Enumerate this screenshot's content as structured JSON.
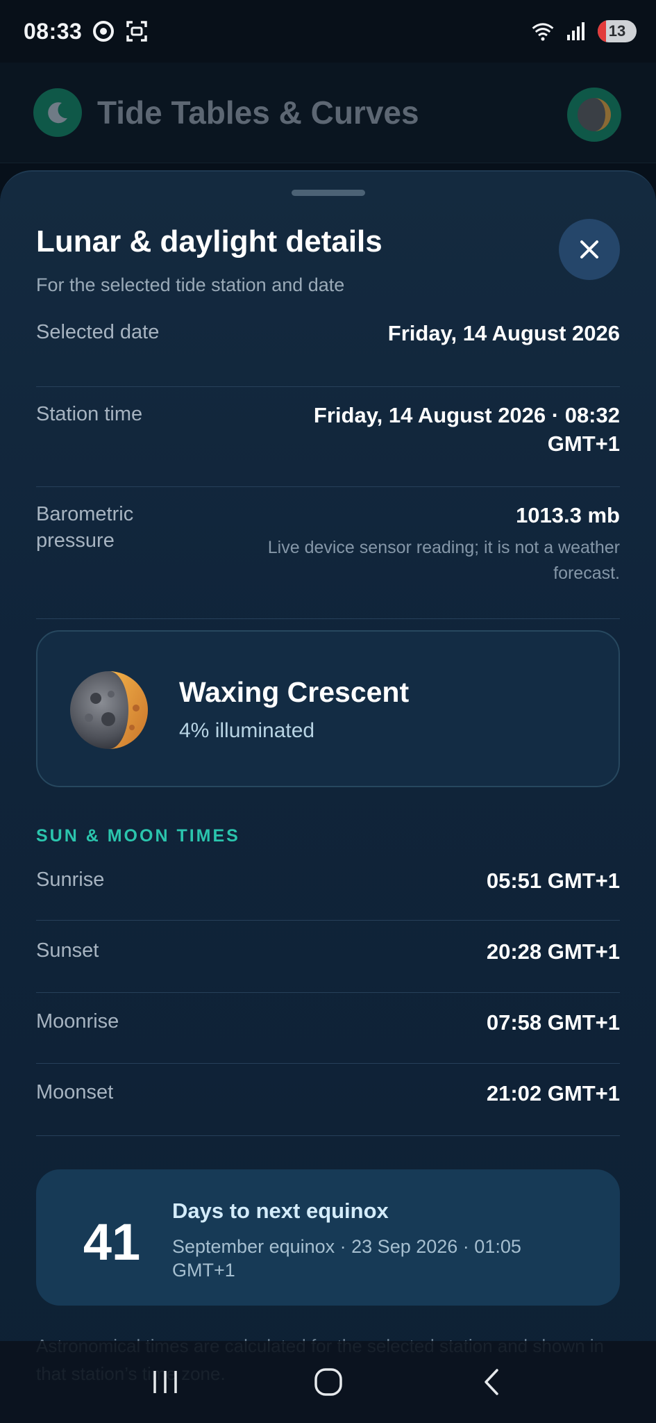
{
  "status_bar": {
    "time": "08:33",
    "battery": "13"
  },
  "app_bar": {
    "title": "Tide Tables & Curves"
  },
  "sheet": {
    "title": "Lunar & daylight details",
    "subtitle": "For the selected tide station and date",
    "details": [
      {
        "label": "Selected date",
        "value": "Friday, 14 August 2026"
      },
      {
        "label": "Station time",
        "value": "Friday, 14 August 2026 · 08:32 GMT+1"
      },
      {
        "label": "Barometric pressure",
        "value": "1013.3 mb",
        "note": "Live device sensor reading; it is not a weather forecast."
      }
    ],
    "moon_phase": {
      "name": "Waxing Crescent",
      "illumination": "4% illuminated"
    },
    "times_heading": "SUN & MOON TIMES",
    "times": [
      {
        "label": "Sunrise",
        "value": "05:51 GMT+1"
      },
      {
        "label": "Sunset",
        "value": "20:28 GMT+1"
      },
      {
        "label": "Moonrise",
        "value": "07:58 GMT+1"
      },
      {
        "label": "Moonset",
        "value": "21:02 GMT+1"
      }
    ],
    "equinox": {
      "days": "41",
      "title": "Days to next equinox",
      "detail": "September equinox · 23 Sep 2026 · 01:05 GMT+1"
    },
    "footnote": "Astronomical times are calculated for the selected station and shown in that station’s time zone."
  },
  "colors": {
    "accent": "#2bc5ad",
    "sheet_background": "#132a40",
    "card_background": "#173a56"
  }
}
